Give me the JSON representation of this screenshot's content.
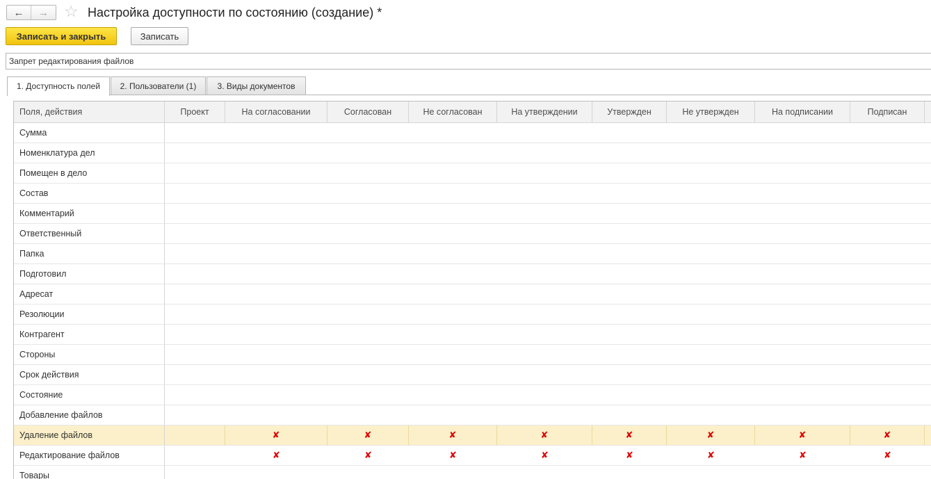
{
  "window": {
    "title": "Настройка доступности по состоянию (создание) *"
  },
  "nav": {
    "back_icon": "←",
    "forward_icon": "→",
    "favorite_icon": "☆"
  },
  "toolbar": {
    "save_close_label": "Записать и закрыть",
    "save_label": "Записать"
  },
  "name_field": {
    "value": "Запрет редактирования файлов"
  },
  "tabs": [
    {
      "label": "1. Доступность полей"
    },
    {
      "label": "2. Пользователи (1)"
    },
    {
      "label": "3. Виды документов"
    }
  ],
  "table": {
    "columns": [
      "Поля, действия",
      "Проект",
      "На согласовании",
      "Согласован",
      "Не согласован",
      "На утверждении",
      "Утвержден",
      "Не утвержден",
      "На подписании",
      "Подписан"
    ],
    "mark_symbol": "✘",
    "mark_color": "#e00000",
    "selected_row_color": "#fbf0c9",
    "rows": [
      {
        "field": "Сумма",
        "marks": [
          false,
          false,
          false,
          false,
          false,
          false,
          false,
          false,
          false
        ]
      },
      {
        "field": "Номенклатура дел",
        "marks": [
          false,
          false,
          false,
          false,
          false,
          false,
          false,
          false,
          false
        ]
      },
      {
        "field": "Помещен в дело",
        "marks": [
          false,
          false,
          false,
          false,
          false,
          false,
          false,
          false,
          false
        ]
      },
      {
        "field": "Состав",
        "marks": [
          false,
          false,
          false,
          false,
          false,
          false,
          false,
          false,
          false
        ]
      },
      {
        "field": "Комментарий",
        "marks": [
          false,
          false,
          false,
          false,
          false,
          false,
          false,
          false,
          false
        ]
      },
      {
        "field": "Ответственный",
        "marks": [
          false,
          false,
          false,
          false,
          false,
          false,
          false,
          false,
          false
        ]
      },
      {
        "field": "Папка",
        "marks": [
          false,
          false,
          false,
          false,
          false,
          false,
          false,
          false,
          false
        ]
      },
      {
        "field": "Подготовил",
        "marks": [
          false,
          false,
          false,
          false,
          false,
          false,
          false,
          false,
          false
        ]
      },
      {
        "field": "Адресат",
        "marks": [
          false,
          false,
          false,
          false,
          false,
          false,
          false,
          false,
          false
        ]
      },
      {
        "field": "Резолюции",
        "marks": [
          false,
          false,
          false,
          false,
          false,
          false,
          false,
          false,
          false
        ]
      },
      {
        "field": "Контрагент",
        "marks": [
          false,
          false,
          false,
          false,
          false,
          false,
          false,
          false,
          false
        ]
      },
      {
        "field": "Стороны",
        "marks": [
          false,
          false,
          false,
          false,
          false,
          false,
          false,
          false,
          false
        ]
      },
      {
        "field": "Срок действия",
        "marks": [
          false,
          false,
          false,
          false,
          false,
          false,
          false,
          false,
          false
        ]
      },
      {
        "field": "Состояние",
        "marks": [
          false,
          false,
          false,
          false,
          false,
          false,
          false,
          false,
          false
        ]
      },
      {
        "field": "Добавление файлов",
        "marks": [
          false,
          false,
          false,
          false,
          false,
          false,
          false,
          false,
          false
        ]
      },
      {
        "field": "Удаление файлов",
        "selected": true,
        "marks": [
          false,
          true,
          true,
          true,
          true,
          true,
          true,
          true,
          true
        ]
      },
      {
        "field": "Редактирование файлов",
        "marks": [
          false,
          true,
          true,
          true,
          true,
          true,
          true,
          true,
          true
        ]
      },
      {
        "field": "Товары",
        "marks": [
          false,
          false,
          false,
          false,
          false,
          false,
          false,
          false,
          false
        ]
      }
    ]
  }
}
